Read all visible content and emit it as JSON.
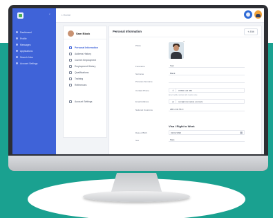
{
  "colors": {
    "background_accent": "#1aa190",
    "sidebar": "#3f63d8",
    "screen_bg": "#f2f4f7",
    "bezel": "#2c2e33"
  },
  "sidebar": {
    "items": [
      {
        "label": "Dashboard",
        "icon": "dashboard-icon"
      },
      {
        "label": "Profile",
        "icon": "user-icon"
      },
      {
        "label": "Messages",
        "icon": "mail-icon"
      },
      {
        "label": "Applications",
        "icon": "briefcase-icon"
      },
      {
        "label": "Search Jobs",
        "icon": "search-icon"
      },
      {
        "label": "Account Settings",
        "icon": "gear-icon"
      }
    ]
  },
  "topbar": {
    "breadcrumb": "Home"
  },
  "profile_menu": {
    "name": "Sam Black",
    "items": [
      {
        "label": "Personal Information",
        "active": true
      },
      {
        "label": "Address History",
        "active": false
      },
      {
        "label": "Current Employment",
        "active": false
      },
      {
        "label": "Employment History",
        "active": false
      },
      {
        "label": "Qualifications",
        "active": false
      },
      {
        "label": "Training",
        "active": false
      },
      {
        "label": "References",
        "active": false
      }
    ],
    "settings_label": "Account Settings"
  },
  "form": {
    "title": "Personal Information",
    "edit_label": "Edit",
    "photo_label": "Photo",
    "fields": [
      {
        "label": "Forename",
        "value": "Sam"
      },
      {
        "label": "Surname",
        "value": "Black"
      },
      {
        "label": "Previous Surname",
        "value": ""
      },
      {
        "label": "Contact Phone",
        "value": "07800 123 456"
      },
      {
        "label": "Email Address",
        "value": "sam@cvtemplate.example"
      },
      {
        "label": "National Insurance",
        "value": "AB 12 34 56 C"
      }
    ],
    "phone_hint": "Enter mobile number with country code",
    "section_title": "Visa / Right to Work",
    "extra_fields": [
      {
        "label": "Date of Birth",
        "value": "01/01/1990"
      },
      {
        "label": "Sex",
        "value": "Male"
      }
    ]
  }
}
